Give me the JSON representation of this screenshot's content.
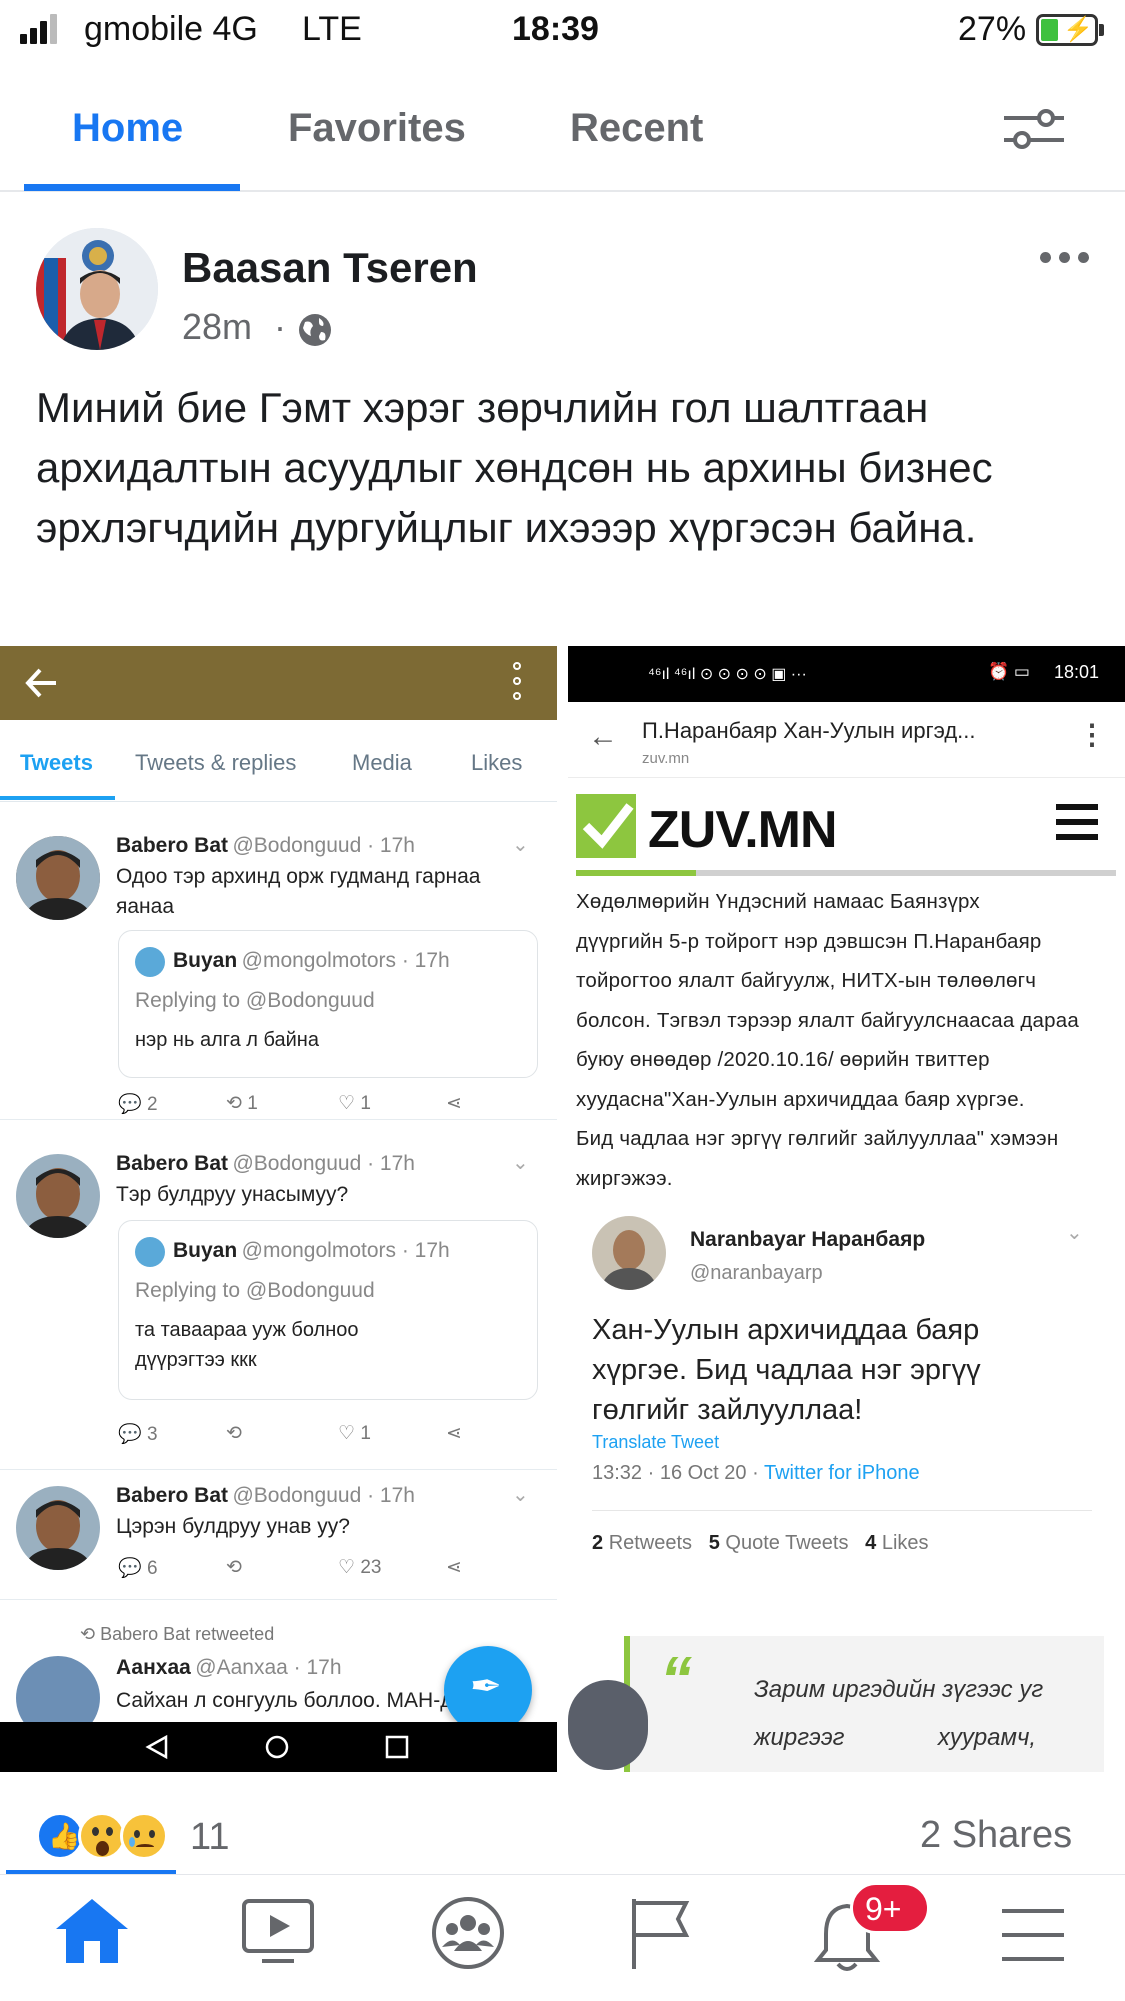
{
  "status_bar": {
    "carrier": "gmobile 4G",
    "network": "LTE",
    "time": "18:39",
    "battery": "27%"
  },
  "tabs": [
    {
      "label": "Home"
    },
    {
      "label": "Favorites"
    },
    {
      "label": "Recent"
    }
  ],
  "post": {
    "author": "Baasan Tseren",
    "time": "28m",
    "privacy_icon": "globe-icon",
    "text": "Миний бие Гэмт хэрэг зөрчлийн гол шалтгаан архидалтын асуудлыг хөндсөн нь архины бизнес эрхлэгчдийн  дургуйцлыг ихэээр хүргэсэн байна."
  },
  "twitter_shot": {
    "tabs": [
      "Tweets",
      "Tweets & replies",
      "Media",
      "Likes"
    ],
    "tweets": [
      {
        "name": "Babero Bat",
        "handle": "@Bodonguud · 17h",
        "text": "Одоо тэр архинд орж гудманд гарнаа яанаа",
        "quote": {
          "name": "Buyan",
          "handle": "@mongolmotors · 17h",
          "replying": "Replying to @Bodonguud",
          "text": "нэр нь алга л байна"
        },
        "replies": "2",
        "retweets": "1",
        "likes": "1"
      },
      {
        "name": "Babero Bat",
        "handle": "@Bodonguud · 17h",
        "text": "Тэр булдруу унасымуу?",
        "quote": {
          "name": "Buyan",
          "handle": "@mongolmotors · 17h",
          "replying": "Replying to @Bodonguud",
          "text": "та таваараа ууж болноо дүүрэгтээ ккк"
        },
        "replies": "3",
        "retweets": "",
        "likes": "1"
      },
      {
        "name": "Babero Bat",
        "handle": "@Bodonguud · 17h",
        "text": "Цэрэн булдруу унав уу?",
        "replies": "6",
        "retweets": "",
        "likes": "23"
      }
    ],
    "retweeted_label": "Babero Bat retweeted",
    "last_tweet": {
      "name": "Аанхаа",
      "handle": "@Aanxaa · 17h",
      "text": "Сайхан л сонгууль боллоо. МАН-д"
    }
  },
  "zuv_shot": {
    "status_time": "18:01",
    "page_title": "П.Наранбаяр Хан-Уулын иргэд...",
    "domain": "zuv.mn",
    "logo": "ZUV.MN",
    "article_lines": [
      "Хөдөлмөрийн    Үндэсний    намаас    Баянзүрх",
      "дүүргийн 5-р тойрогт нэр дэвшсэн П.Наранбаяр",
      "тойрогтоо ялалт байгуулж, НИТХ-ын төлөөлөгч",
      "болсон. Тэгвэл тэрээр ялалт байгуулснаасаа дараа",
      "буюу  өнөөдөр  /2020.10.16/  өөрийн  твиттер",
      "хуудасна\"Хан-Уулын архичиддаа баяр хүргэе.",
      "Бид чадлаа нэг эргүү гөлгийг зайлууллаа\" хэмээн",
      "жиргэжээ."
    ],
    "embed": {
      "name": "Naranbayar Наранбаяр",
      "handle": "@naranbayarp",
      "text": "Хан-Уулын архичиддаа баяр хүргэе. Бид чадлаа нэг эргүү гөлгийг зайлууллаа!",
      "translate": "Translate Tweet",
      "date": "13:32 · 16 Oct 20 · ",
      "client": "Twitter for iPhone",
      "retweets_n": "2",
      "retweets_l": "Retweets",
      "quotes_n": "5",
      "quotes_l": "Quote Tweets",
      "likes_n": "4",
      "likes_l": "Likes"
    },
    "quote_mark": "“",
    "quote_line1": "Зарим иргэдийн зүгээс уг",
    "quote_line2": "жиргээг              хуурамч,"
  },
  "reactions": {
    "count": "11",
    "shares": "2 Shares",
    "icons": [
      "like-icon",
      "wow-icon",
      "sad-icon"
    ]
  },
  "bottom_nav": {
    "items": [
      "home-icon",
      "video-icon",
      "groups-icon",
      "pages-icon",
      "notifications-icon",
      "menu-icon"
    ],
    "badge": "9+"
  },
  "colors": {
    "accent": "#1877f2",
    "twitter_blue": "#1da1f2",
    "header_brown": "#7d6a34",
    "zuv_green": "#8dc63f",
    "badge_red": "#e41e3f"
  }
}
